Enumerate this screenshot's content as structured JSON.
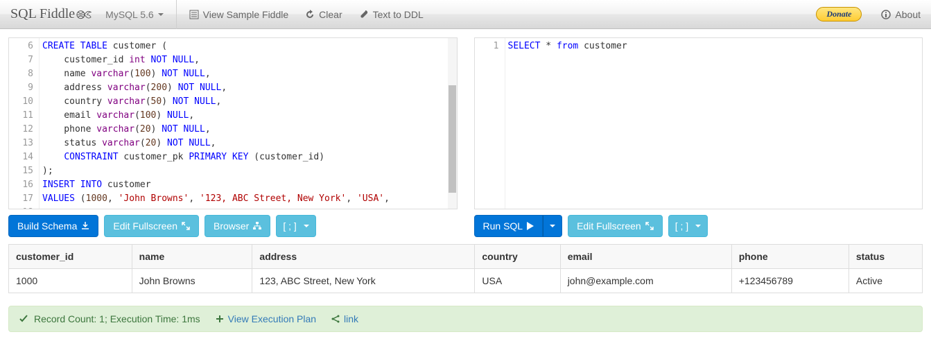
{
  "nav": {
    "brand": "SQL Fiddle",
    "db": "MySQL 5.6",
    "viewSample": "View Sample Fiddle",
    "clear": "Clear",
    "textToDDL": "Text to DDL",
    "donate": "Donate",
    "about": "About"
  },
  "schemaEditor": {
    "startLine": 6,
    "lines": [
      {
        "t": "CREATE TABLE customer (",
        "tokens": [
          [
            "kw",
            "CREATE"
          ],
          [
            "",
            "TABLE"
          ],
          [
            "id",
            "customer"
          ],
          [
            "punc",
            "("
          ]
        ],
        "raw": "<span class='kw'>CREATE</span> <span class='kw'>TABLE</span> customer ("
      },
      {
        "raw": "    customer_id <span class='type'>int</span> <span class='kw'>NOT</span> <span class='kw'>NULL</span>,"
      },
      {
        "raw": "    name <span class='type'>varchar</span>(<span class='lit'>100</span>) <span class='kw'>NOT</span> <span class='kw'>NULL</span>,"
      },
      {
        "raw": "    address <span class='type'>varchar</span>(<span class='lit'>200</span>) <span class='kw'>NOT</span> <span class='kw'>NULL</span>,"
      },
      {
        "raw": "    country <span class='type'>varchar</span>(<span class='lit'>50</span>) <span class='kw'>NOT</span> <span class='kw'>NULL</span>,"
      },
      {
        "raw": "    email <span class='type'>varchar</span>(<span class='lit'>100</span>) <span class='kw'>NULL</span>,"
      },
      {
        "raw": "    phone <span class='type'>varchar</span>(<span class='lit'>20</span>) <span class='kw'>NOT</span> <span class='kw'>NULL</span>,"
      },
      {
        "raw": "    status <span class='type'>varchar</span>(<span class='lit'>20</span>) <span class='kw'>NOT</span> <span class='kw'>NULL</span>,"
      },
      {
        "raw": "    <span class='kw'>CONSTRAINT</span> customer_pk <span class='kw'>PRIMARY</span> <span class='kw'>KEY</span> (customer_id)"
      },
      {
        "raw": ");"
      },
      {
        "raw": ""
      },
      {
        "raw": "<span class='kw'>INSERT</span> <span class='kw'>INTO</span> customer"
      },
      {
        "raw": "<span class='kw'>VALUES</span> (<span class='lit'>1000</span>, <span class='str'>'John Browns'</span>, <span class='str'>'123, ABC Street, New York'</span>, <span class='str'>'USA'</span>,"
      }
    ],
    "buildSchema": "Build Schema",
    "editFullscreen": "Edit Fullscreen",
    "browser": "Browser",
    "terminator": "[ ; ]"
  },
  "queryEditor": {
    "startLine": 1,
    "lines": [
      {
        "raw": "<span class='kw'>SELECT</span> * <span class='kw'>from</span> customer"
      }
    ],
    "runSQL": "Run SQL",
    "editFullscreen": "Edit Fullscreen",
    "terminator": "[ ; ]"
  },
  "results": {
    "headers": [
      "customer_id",
      "name",
      "address",
      "country",
      "email",
      "phone",
      "status"
    ],
    "rows": [
      [
        "1000",
        "John Browns",
        "123, ABC Street, New York",
        "USA",
        "john@example.com",
        "+123456789",
        "Active"
      ]
    ]
  },
  "status": {
    "summary": "Record Count: 1; Execution Time: 1ms",
    "execPlan": "View Execution Plan",
    "link": "link"
  }
}
